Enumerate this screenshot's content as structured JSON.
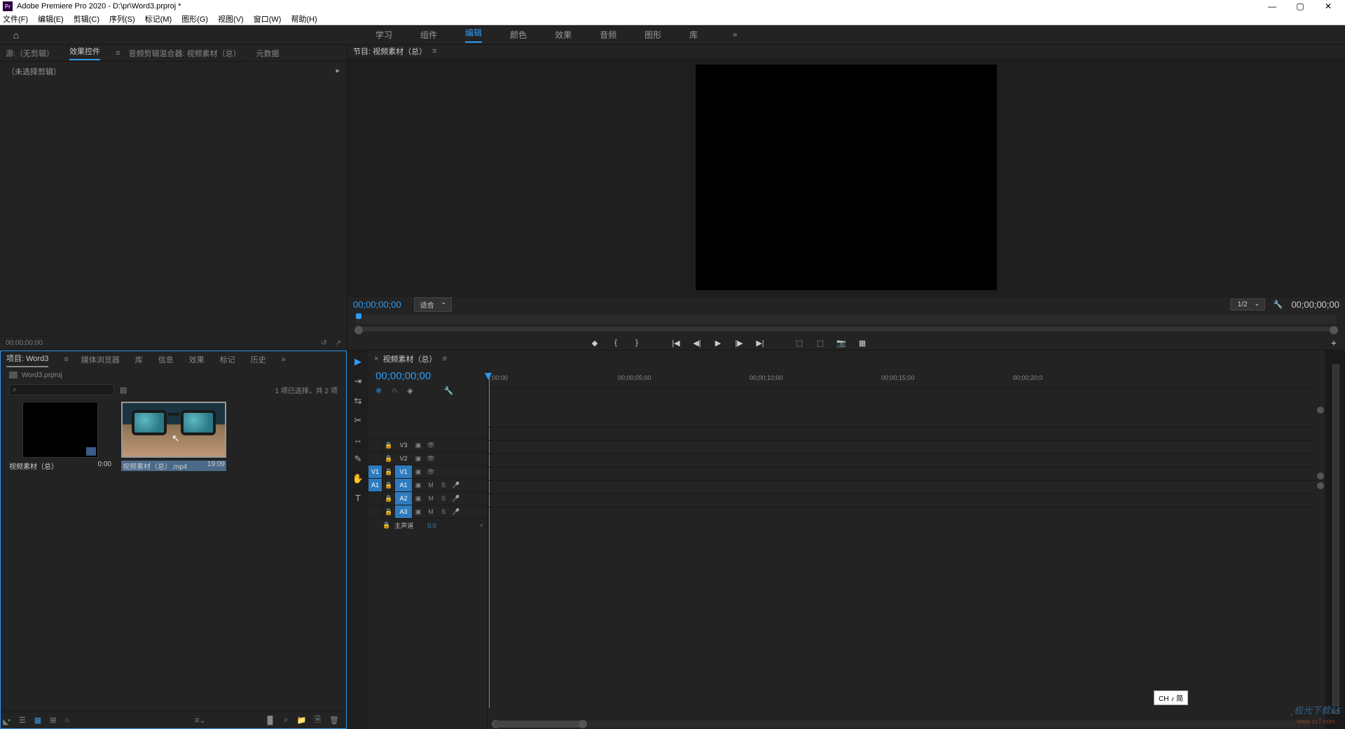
{
  "title": "Adobe Premiere Pro 2020 - D:\\pr\\Word3.prproj *",
  "menus": [
    "文件(F)",
    "编辑(E)",
    "剪辑(C)",
    "序列(S)",
    "标记(M)",
    "图形(G)",
    "视图(V)",
    "窗口(W)",
    "帮助(H)"
  ],
  "workspaces": [
    "学习",
    "组件",
    "编辑",
    "颜色",
    "效果",
    "音频",
    "图形",
    "库"
  ],
  "workspace_active": "编辑",
  "ec": {
    "tabs": [
      "源:（无剪辑）",
      "效果控件",
      "音频剪辑混合器: 视频素材（总）",
      "元数据"
    ],
    "active": "效果控件",
    "body": "（未选择剪辑）",
    "footer": "00;00;00;00"
  },
  "program": {
    "title": "节目: 视频素材（总）",
    "tc_left": "00;00;00;00",
    "fit": "适合",
    "zoom": "1/2",
    "tc_right": "00;00;00;00"
  },
  "project": {
    "tabs": [
      "项目: Word3",
      "媒体浏览器",
      "库",
      "信息",
      "效果",
      "标记",
      "历史"
    ],
    "active": "项目: Word3",
    "filename": "Word3.prproj",
    "status": "1 项已选择，共 2 项",
    "items": [
      {
        "name": "视频素材（总）",
        "dur": "0:00"
      },
      {
        "name": "视频素材（总）.mp4",
        "dur": "19:09"
      }
    ]
  },
  "timeline": {
    "title": "视频素材（总）",
    "tc": "00;00;00;00",
    "ruler": [
      ":00:00",
      "00;00;05;00",
      "00;00;10;00",
      "00;00;15;00",
      "00;00;20;0"
    ],
    "vtracks": [
      "V3",
      "V2",
      "V1"
    ],
    "atracks": [
      "A1",
      "A2",
      "A3"
    ],
    "master": "主声道",
    "master_val": "0.0"
  },
  "ime": "CH ♪ 简"
}
